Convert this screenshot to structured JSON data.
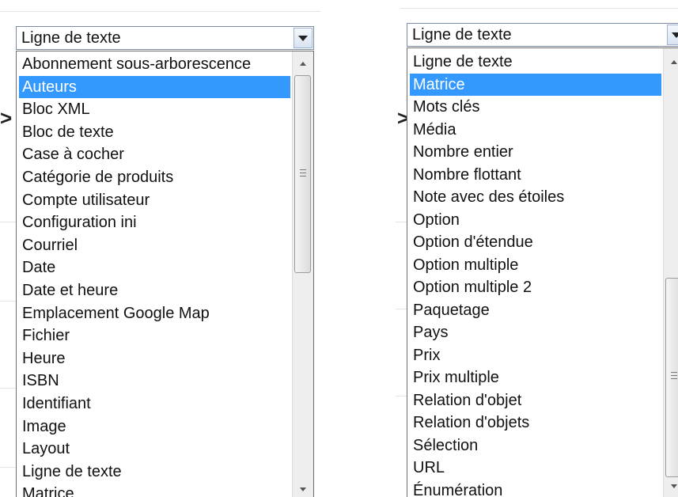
{
  "left": {
    "combo_value": "Ligne de texte",
    "selected_index": 1,
    "items": [
      "Abonnement sous-arborescence",
      "Auteurs",
      "Bloc XML",
      "Bloc de texte",
      "Case à cocher",
      "Catégorie de produits",
      "Compte utilisateur",
      "Configuration ini",
      "Courriel",
      "Date",
      "Date et heure",
      "Emplacement Google Map",
      "Fichier",
      "Heure",
      "ISBN",
      "Identifiant",
      "Image",
      "Layout",
      "Ligne de texte",
      "Matrice"
    ],
    "scroll_position": 0.0
  },
  "right": {
    "combo_value": "Ligne de texte",
    "selected_index": 1,
    "items": [
      "Ligne de texte",
      "Matrice",
      "Mots clés",
      "Média",
      "Nombre entier",
      "Nombre flottant",
      "Note avec des étoiles",
      "Option",
      "Option d'étendue",
      "Option multiple",
      "Option multiple 2",
      "Paquetage",
      "Pays",
      "Prix",
      "Prix multiple",
      "Relation d'objet",
      "Relation d'objets",
      "Sélection",
      "URL",
      "Énumération"
    ],
    "scroll_position": 1.0
  },
  "colors": {
    "selection": "#3399ff",
    "border": "#6e6e6e"
  }
}
